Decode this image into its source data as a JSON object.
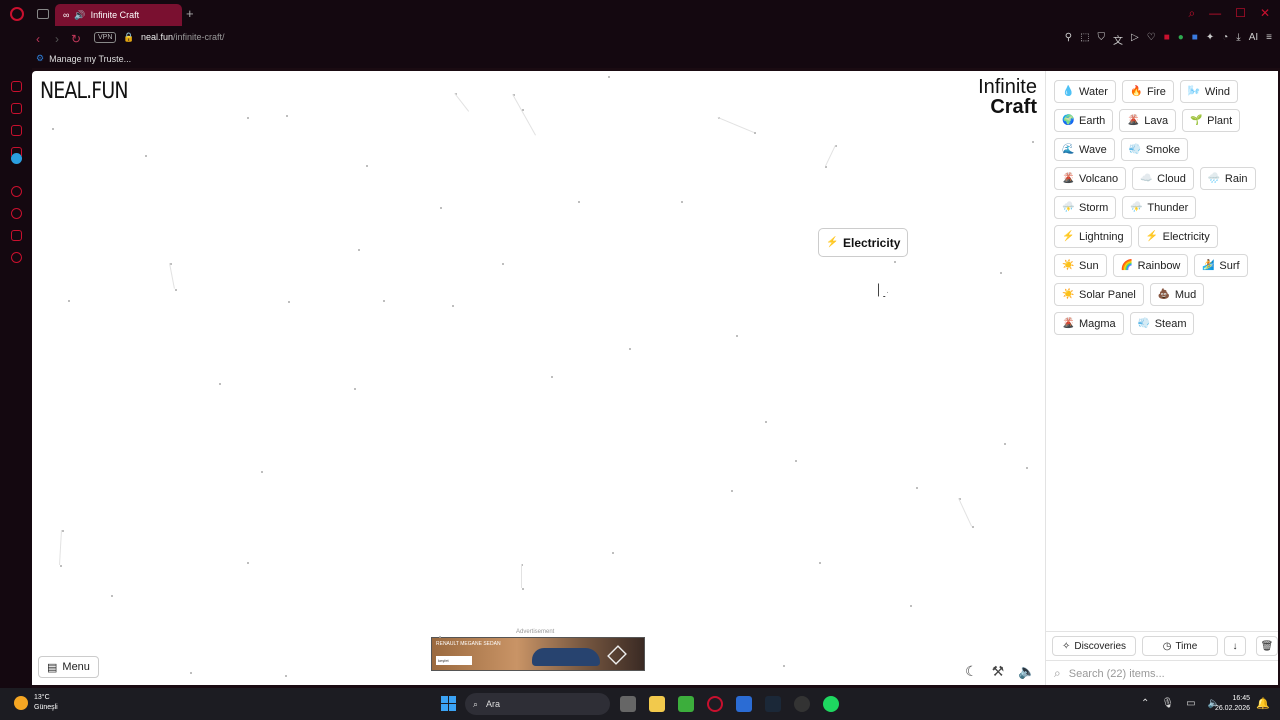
{
  "browser": {
    "tab_title": "Infinite Craft",
    "url_host": "neal.fun",
    "url_path": "/infinite-craft/",
    "vpn_label": "VPN",
    "bookmark": "Manage my Truste...",
    "ai_label": "AI"
  },
  "page": {
    "logo": "NEAL.FUN",
    "brand_line1": "Infinite",
    "brand_line2": "Craft",
    "canvas_item": {
      "emoji": "⚡",
      "label": "Electricity"
    },
    "menu_label": "Menu",
    "ad_label": "Advertisement",
    "ad_text": "RENAULT MEGANE SEDAN",
    "ad_button": "keşfet"
  },
  "elements": [
    [
      {
        "e": "💧",
        "n": "Water"
      },
      {
        "e": "🔥",
        "n": "Fire"
      },
      {
        "e": "🌬️",
        "n": "Wind"
      }
    ],
    [
      {
        "e": "🌍",
        "n": "Earth"
      },
      {
        "e": "🌋",
        "n": "Lava"
      },
      {
        "e": "🌱",
        "n": "Plant"
      }
    ],
    [
      {
        "e": "🌊",
        "n": "Wave"
      },
      {
        "e": "💨",
        "n": "Smoke"
      }
    ],
    [
      {
        "e": "🌋",
        "n": "Volcano"
      },
      {
        "e": "☁️",
        "n": "Cloud"
      },
      {
        "e": "🌧️",
        "n": "Rain"
      }
    ],
    [
      {
        "e": "⛈️",
        "n": "Storm"
      },
      {
        "e": "⛈️",
        "n": "Thunder"
      }
    ],
    [
      {
        "e": "⚡",
        "n": "Lightning"
      },
      {
        "e": "⚡",
        "n": "Electricity"
      }
    ],
    [
      {
        "e": "☀️",
        "n": "Sun"
      },
      {
        "e": "🌈",
        "n": "Rainbow"
      },
      {
        "e": "🏄",
        "n": "Surf"
      }
    ],
    [
      {
        "e": "☀️",
        "n": "Solar Panel"
      },
      {
        "e": "💩",
        "n": "Mud"
      }
    ],
    [
      {
        "e": "🌋",
        "n": "Magma"
      },
      {
        "e": "💨",
        "n": "Steam"
      }
    ]
  ],
  "panel": {
    "discoveries_label": "Discoveries",
    "time_label": "Time",
    "search_placeholder": "Search (22) items..."
  },
  "taskbar": {
    "temp": "13°C",
    "weather": "Güneşli",
    "search_label": "Ara",
    "time": "16:45",
    "date": "26.02.2026"
  }
}
